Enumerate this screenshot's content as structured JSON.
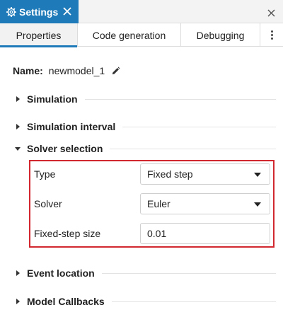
{
  "window": {
    "tab_title": "Settings",
    "tab_icon": "gear-icon",
    "close_tab_icon": "close-icon",
    "close_panel_icon": "close-icon",
    "accent_color": "#1e7ab8"
  },
  "subtabs": [
    {
      "label": "Properties",
      "active": true
    },
    {
      "label": "Code generation",
      "active": false
    },
    {
      "label": "Debugging",
      "active": false
    }
  ],
  "more_icon": "kebab-menu-icon",
  "model": {
    "name_label": "Name:",
    "name_value": "newmodel_1",
    "edit_icon": "pencil-icon"
  },
  "sections": {
    "simulation": "Simulation",
    "simulation_interval": "Simulation interval",
    "solver_selection": "Solver selection",
    "event_location": "Event location",
    "model_callbacks": "Model Callbacks"
  },
  "solver": {
    "highlight_color": "#d3272f",
    "type_label": "Type",
    "type_value": "Fixed step",
    "solver_label": "Solver",
    "solver_value": "Euler",
    "step_label": "Fixed-step size",
    "step_value": "0.01"
  }
}
